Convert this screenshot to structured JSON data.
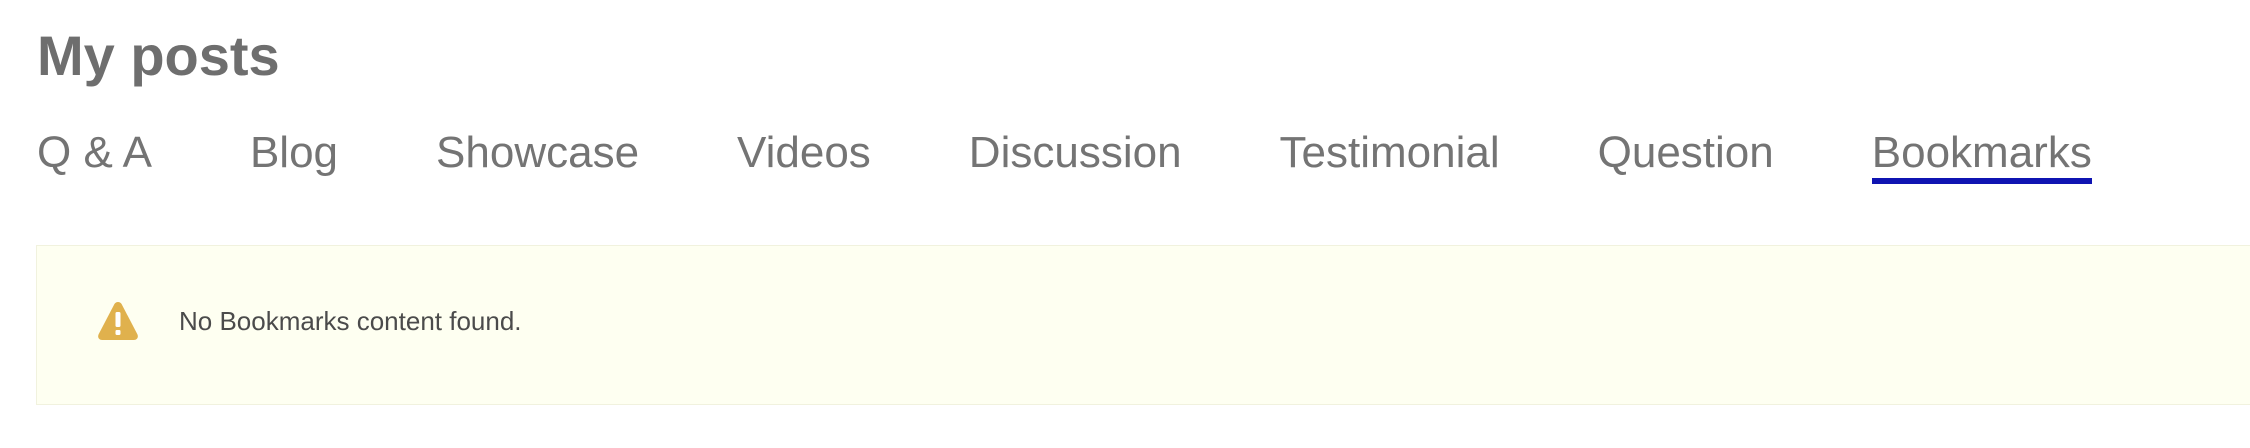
{
  "page": {
    "title": "My posts"
  },
  "tabs": [
    {
      "label": "Q & A",
      "active": false
    },
    {
      "label": "Blog",
      "active": false
    },
    {
      "label": "Showcase",
      "active": false
    },
    {
      "label": "Videos",
      "active": false
    },
    {
      "label": "Discussion",
      "active": false
    },
    {
      "label": "Testimonial",
      "active": false
    },
    {
      "label": "Question",
      "active": false
    },
    {
      "label": "Bookmarks",
      "active": true
    }
  ],
  "alert": {
    "icon": "warning-triangle-icon",
    "message": "No Bookmarks content found."
  },
  "colors": {
    "title": "#6e6e6e",
    "tab_text": "#747474",
    "active_underline": "#0f14b2",
    "alert_background": "#fefff1",
    "warning_icon": "#e0b14d"
  }
}
